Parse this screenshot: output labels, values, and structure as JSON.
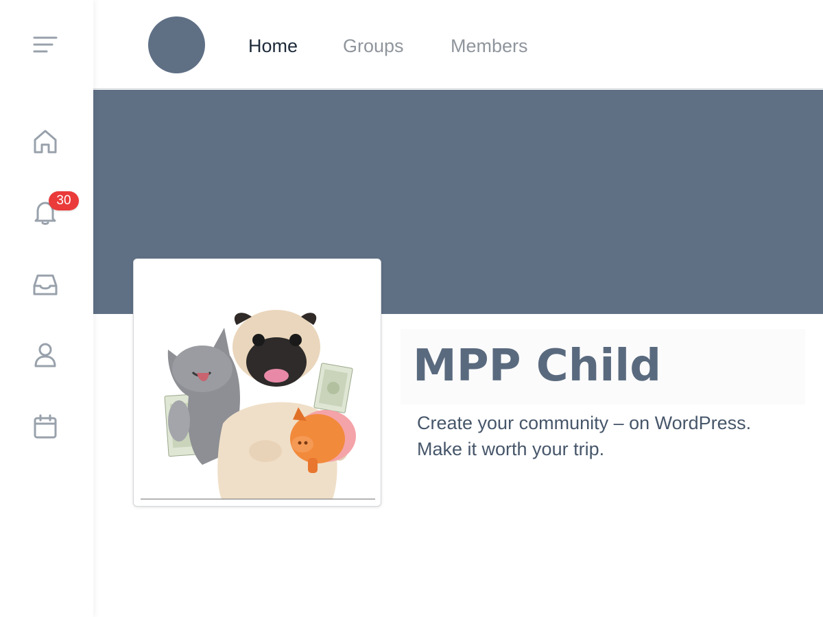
{
  "sidebar": {
    "items": [
      {
        "icon": "menu-icon"
      },
      {
        "icon": "home-icon"
      },
      {
        "icon": "bell-icon",
        "badge": "30"
      },
      {
        "icon": "inbox-icon"
      },
      {
        "icon": "user-icon"
      },
      {
        "icon": "calendar-icon"
      }
    ]
  },
  "nav": {
    "links": [
      "Home",
      "Groups",
      "Members"
    ],
    "active": "Home"
  },
  "group": {
    "name": "MPP Child",
    "description_line1": "Create your community – on WordPress.",
    "description_line2": "Make it worth your trip."
  },
  "colors": {
    "cover": "#5f7085",
    "badge": "#ea3a3a",
    "icon": "#98a1ab",
    "title": "#5a6a7e"
  }
}
